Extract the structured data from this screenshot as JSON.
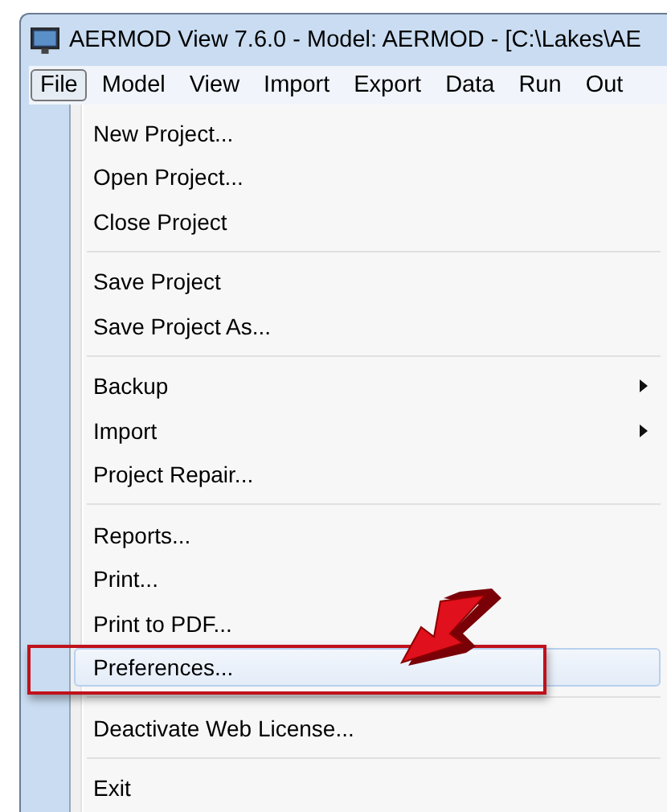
{
  "window": {
    "title": "AERMOD View 7.6.0 - Model: AERMOD  - [C:\\Lakes\\AE"
  },
  "menubar": [
    {
      "label": "File",
      "selected": true
    },
    {
      "label": "Model",
      "selected": false
    },
    {
      "label": "View",
      "selected": false
    },
    {
      "label": "Import",
      "selected": false
    },
    {
      "label": "Export",
      "selected": false
    },
    {
      "label": "Data",
      "selected": false
    },
    {
      "label": "Run",
      "selected": false
    },
    {
      "label": "Out",
      "selected": false
    }
  ],
  "menu": {
    "groups": [
      [
        {
          "label": "New Project...",
          "submenu": false,
          "selected": false
        },
        {
          "label": "Open Project...",
          "submenu": false,
          "selected": false
        },
        {
          "label": "Close Project",
          "submenu": false,
          "selected": false
        }
      ],
      [
        {
          "label": "Save Project",
          "submenu": false,
          "selected": false
        },
        {
          "label": "Save Project As...",
          "submenu": false,
          "selected": false
        }
      ],
      [
        {
          "label": "Backup",
          "submenu": true,
          "selected": false
        },
        {
          "label": "Import",
          "submenu": true,
          "selected": false
        },
        {
          "label": "Project Repair...",
          "submenu": false,
          "selected": false
        }
      ],
      [
        {
          "label": "Reports...",
          "submenu": false,
          "selected": false
        },
        {
          "label": "Print...",
          "submenu": false,
          "selected": false
        },
        {
          "label": "Print to PDF...",
          "submenu": false,
          "selected": false
        },
        {
          "label": "Preferences...",
          "submenu": false,
          "selected": true,
          "callout": true
        }
      ],
      [
        {
          "label": "Deactivate Web License...",
          "submenu": false,
          "selected": false
        }
      ],
      [
        {
          "label": "Exit",
          "submenu": false,
          "selected": false
        }
      ]
    ]
  }
}
